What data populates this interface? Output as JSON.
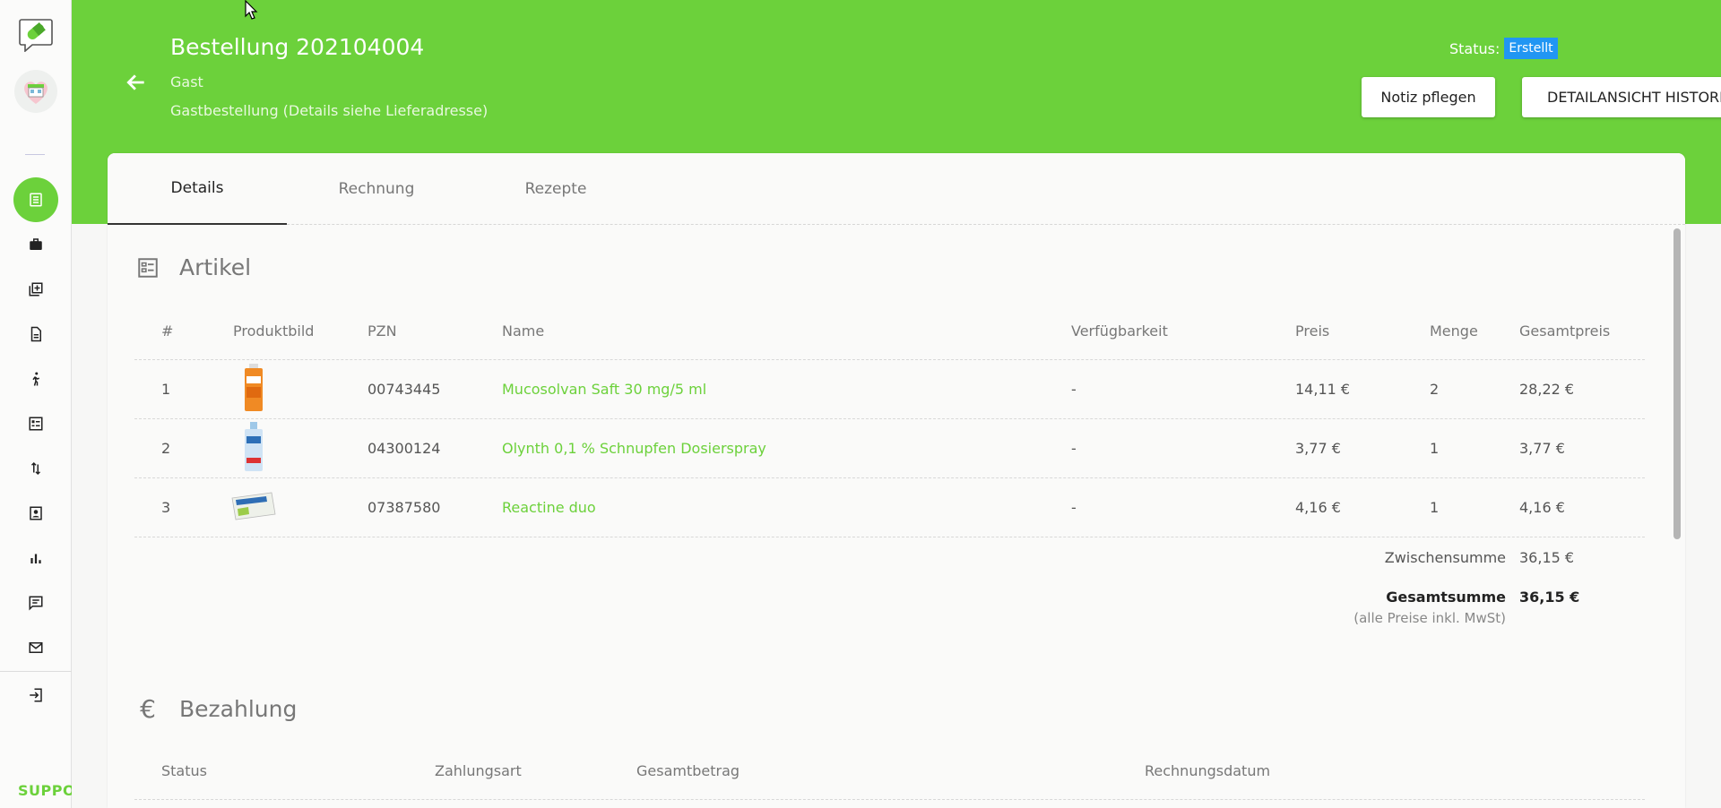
{
  "colors": {
    "brand": "#6cd13b",
    "status": "#2196f3"
  },
  "sidebar": {
    "items": [
      {
        "icon": "orders-icon",
        "active": true
      },
      {
        "icon": "briefcase-icon",
        "active": false
      },
      {
        "icon": "add-library-icon",
        "active": false
      },
      {
        "icon": "document-icon",
        "active": false
      },
      {
        "icon": "walking-person-icon",
        "active": false
      },
      {
        "icon": "checklist-icon",
        "active": false
      },
      {
        "icon": "sort-arrows-icon",
        "active": false
      },
      {
        "icon": "contact-card-icon",
        "active": false
      },
      {
        "icon": "bar-chart-icon",
        "active": false
      },
      {
        "icon": "chat-icon",
        "active": false
      },
      {
        "icon": "mail-icon",
        "active": false
      },
      {
        "icon": "logout-icon",
        "active": false
      }
    ],
    "support_label": "SUPPO"
  },
  "header": {
    "title": "Bestellung 202104004",
    "customer": "Gast",
    "subtitle": "Gastbestellung (Details siehe Lieferadresse)",
    "status_label": "Status:",
    "status_value": "Erstellt",
    "note_button": "Notiz pflegen",
    "history_button": "DETAILANSICHT HISTORIE"
  },
  "tabs": [
    {
      "label": "Details",
      "active": true
    },
    {
      "label": "Rechnung",
      "active": false
    },
    {
      "label": "Rezepte",
      "active": false
    }
  ],
  "articles": {
    "title": "Artikel",
    "columns": [
      "#",
      "Produktbild",
      "PZN",
      "Name",
      "Verfügbarkeit",
      "Preis",
      "Menge",
      "Gesamtpreis"
    ],
    "rows": [
      {
        "num": "1",
        "pzn": "00743445",
        "name": "Mucosolvan Saft 30 mg/5 ml",
        "availability": "-",
        "price": "14,11 €",
        "qty": "2",
        "total": "28,22 €"
      },
      {
        "num": "2",
        "pzn": "04300124",
        "name": "Olynth 0,1 % Schnupfen Dosierspray",
        "availability": "-",
        "price": "3,77 €",
        "qty": "1",
        "total": "3,77 €"
      },
      {
        "num": "3",
        "pzn": "07387580",
        "name": "Reactine duo",
        "availability": "-",
        "price": "4,16 €",
        "qty": "1",
        "total": "4,16 €"
      }
    ],
    "subtotal_label": "Zwischensumme",
    "subtotal_value": "36,15 €",
    "total_label": "Gesamtsumme",
    "total_value": "36,15 €",
    "vat_note": "(alle Preise inkl. MwSt)"
  },
  "payment": {
    "title": "Bezahlung",
    "columns": [
      "Status",
      "Zahlungsart",
      "Gesamtbetrag",
      "Rechnungsdatum"
    ]
  }
}
